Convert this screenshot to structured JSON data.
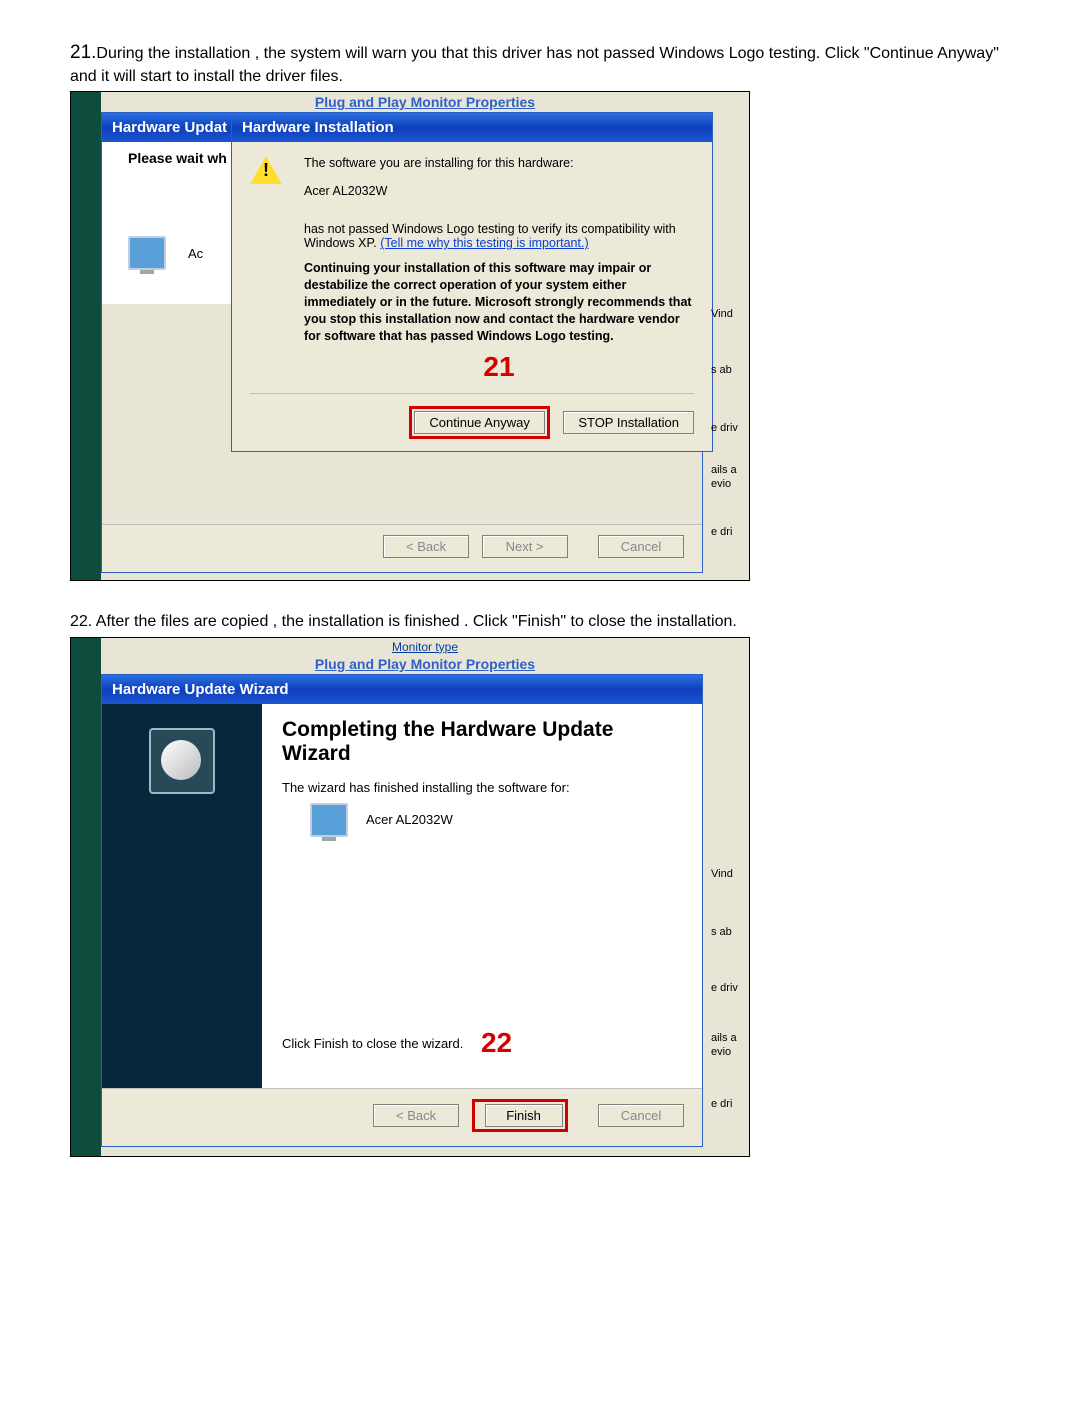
{
  "step21": {
    "num": "21.",
    "text": "During the installation , the system will warn you that this driver has not passed Windows Logo testing. Click \"Continue Anyway\" and it will start to install the driver files."
  },
  "shot1": {
    "pnp_title": "Plug and Play Monitor Properties",
    "wizard_title": "Hardware Updat",
    "please_wait": "Please wait wh",
    "ac_label": "Ac",
    "dlg_title": "Hardware Installation",
    "intro": "The software you are installing for this hardware:",
    "device": "Acer AL2032W",
    "logo1": "has not passed Windows Logo testing to verify its compatibility with Windows XP.",
    "logo_link": "(Tell me why this testing is important.)",
    "bold_msg": "Continuing your installation of this software may impair or destabilize the correct operation of your system either immediately or in the future. Microsoft strongly recommends that you stop this installation now and contact the hardware vendor for software that has passed Windows Logo testing.",
    "red_num": "21",
    "btn_continue": "Continue Anyway",
    "btn_stop": "STOP Installation",
    "wiz_back": "< Back",
    "wiz_next": "Next >",
    "wiz_cancel": "Cancel",
    "frags": {
      "a": "Vind",
      "b": "s ab",
      "c": "e driv",
      "d": "ails a",
      "e": "evio",
      "f": "e dri"
    }
  },
  "step22": {
    "text": "22. After the files are copied , the installation is finished . Click \"Finish\" to close the installation."
  },
  "shot2": {
    "monitor_type": "Monitor type",
    "pnp_title": "Plug and Play Monitor Properties",
    "wizard_title": "Hardware Update Wizard",
    "heading": "Completing the Hardware Update Wizard",
    "finished_for": "The wizard has finished installing the software for:",
    "device": "Acer AL2032W",
    "finish_hint": "Click Finish to close the wizard.",
    "red_num": "22",
    "btn_back": "< Back",
    "btn_finish": "Finish",
    "btn_cancel": "Cancel",
    "frags": {
      "a": "Vind",
      "b": "s ab",
      "c": "e driv",
      "d": "ails a",
      "e": "evio",
      "f": "e dri"
    }
  }
}
